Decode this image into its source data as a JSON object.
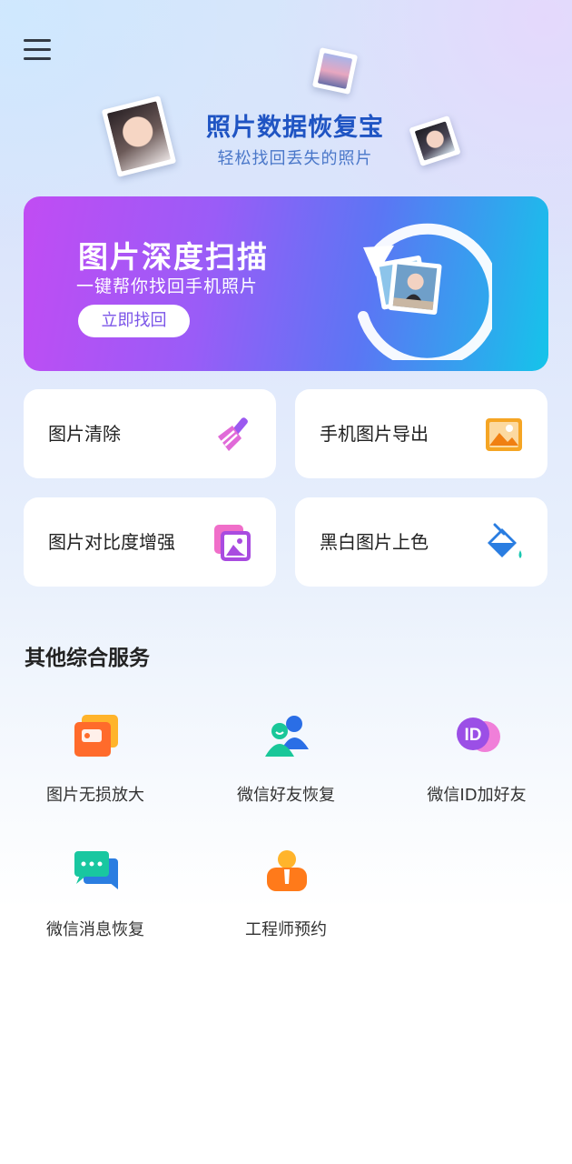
{
  "header": {
    "menu_icon": "hamburger-menu-icon",
    "app_title": "照片数据恢复宝",
    "app_subtitle": "轻松找回丢失的照片"
  },
  "banner": {
    "title": "图片深度扫描",
    "subtitle": "一键帮你找回手机照片",
    "button_label": "立即找回",
    "gradient": [
      "#c14cf3",
      "#9a5cf7",
      "#5b76f4",
      "#15c4ea"
    ]
  },
  "features": [
    {
      "label": "图片清除",
      "icon": "broom-icon",
      "color": "#c35cf0"
    },
    {
      "label": "手机图片导出",
      "icon": "image-export-icon",
      "color": "#f5a524"
    },
    {
      "label": "图片对比度增强",
      "icon": "contrast-image-icon",
      "color": "#b54ce0"
    },
    {
      "label": "黑白图片上色",
      "icon": "paint-bucket-icon",
      "color": "#2a7de1"
    }
  ],
  "services": {
    "title": "其他综合服务",
    "items": [
      {
        "label": "图片无损放大",
        "icon": "image-enlarge-icon"
      },
      {
        "label": "微信好友恢复",
        "icon": "contacts-recover-icon"
      },
      {
        "label": "微信ID加好友",
        "icon": "id-add-friend-icon"
      },
      {
        "label": "微信消息恢复",
        "icon": "chat-recover-icon"
      },
      {
        "label": "工程师预约",
        "icon": "engineer-icon"
      }
    ]
  }
}
